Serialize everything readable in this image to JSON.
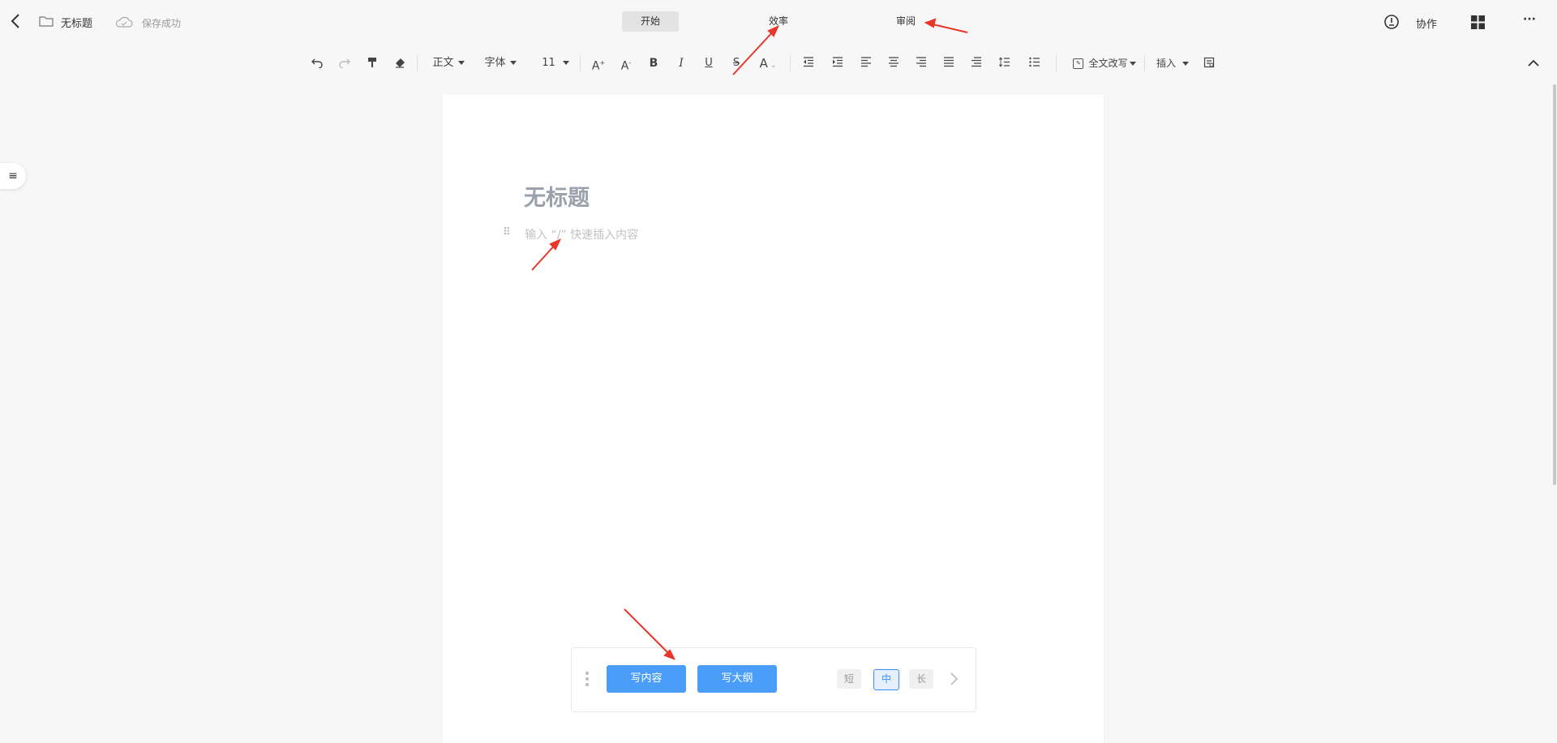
{
  "header": {
    "doc_title": "无标题",
    "save_status": "保存成功",
    "tabs": [
      {
        "label": "开始",
        "active": true
      },
      {
        "label": "效率",
        "active": false
      },
      {
        "label": "审阅",
        "active": false
      }
    ],
    "collab_label": "协作",
    "more_label": "···"
  },
  "toolbar": {
    "paragraph_style": "正文",
    "font_family": "字体",
    "font_size": "11",
    "rewrite_label": "全文改写",
    "insert_label": "插入"
  },
  "document": {
    "title_placeholder": "无标题",
    "body_placeholder": "输入 “/” 快速插入内容"
  },
  "ai_bar": {
    "write_content": "写内容",
    "write_outline": "写大纲",
    "length_options": [
      {
        "label": "短",
        "selected": false
      },
      {
        "label": "中",
        "selected": true
      },
      {
        "label": "长",
        "selected": false
      }
    ]
  },
  "colors": {
    "accent": "#4a9df8",
    "annotation_arrow": "#e8362a"
  }
}
